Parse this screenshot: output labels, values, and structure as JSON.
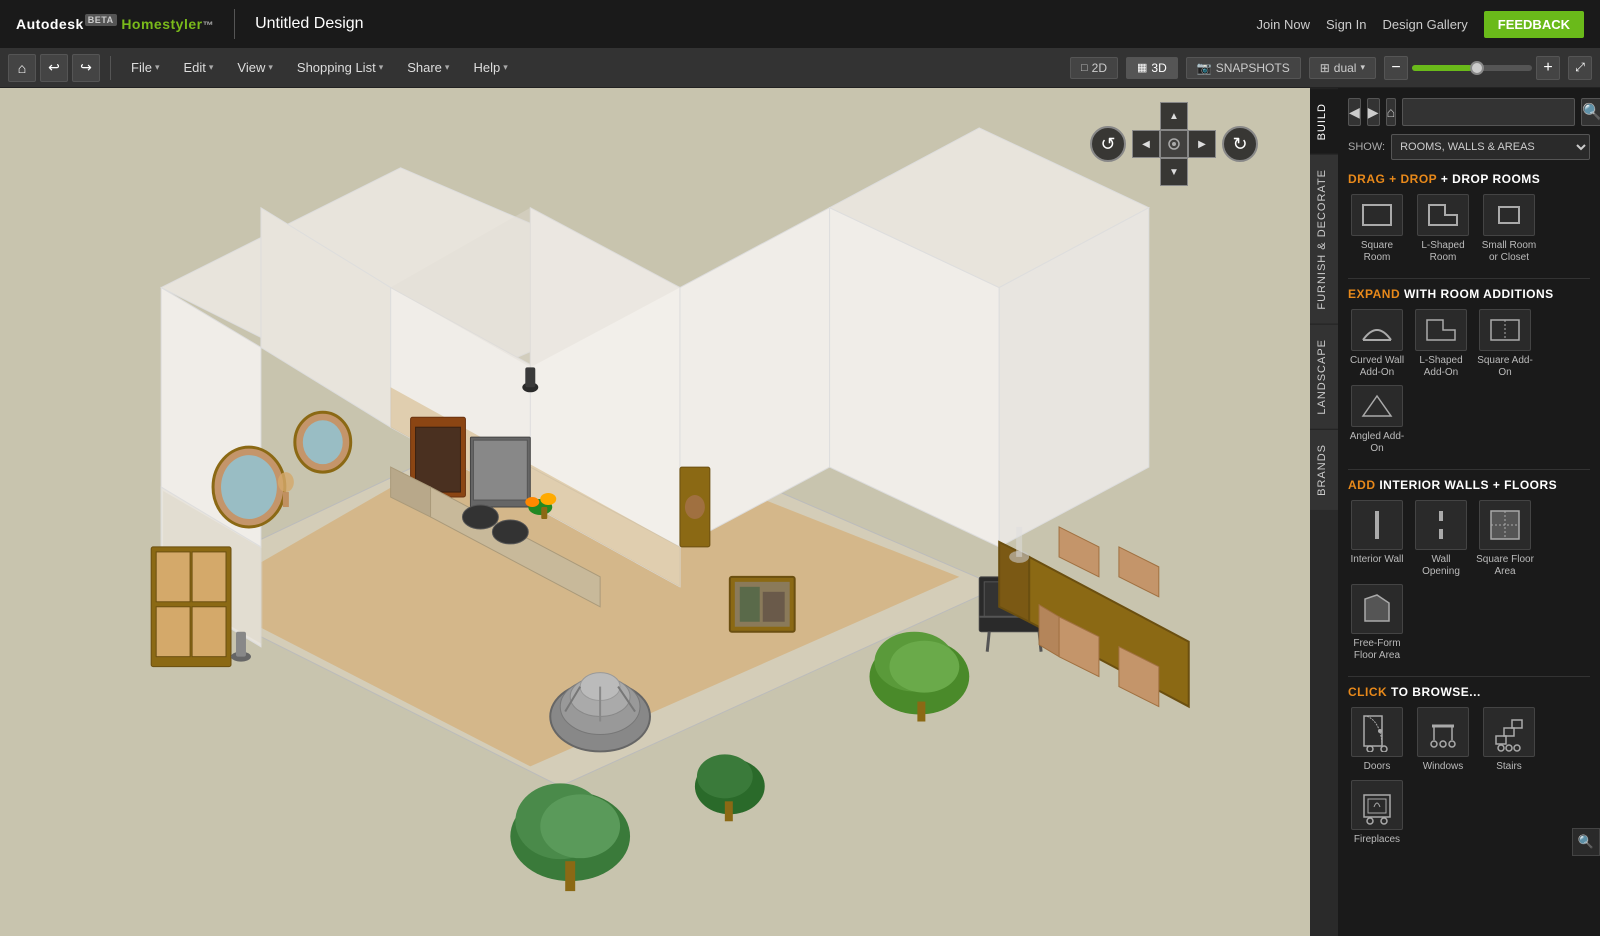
{
  "app": {
    "name": "Autodesk Homestyler",
    "beta_label": "BETA",
    "design_title": "Untitled Design",
    "feedback_btn": "FEEDBACK"
  },
  "top_links": {
    "join_now": "Join Now",
    "sign_in": "Sign In",
    "design_gallery": "Design Gallery"
  },
  "menu": {
    "home_icon": "⌂",
    "undo_icon": "↩",
    "redo_icon": "↪",
    "file": "File",
    "edit": "Edit",
    "view": "View",
    "shopping_list": "Shopping List",
    "share": "Share",
    "help": "Help"
  },
  "view_controls": {
    "btn_2d": "2D",
    "btn_3d": "3D",
    "snapshots": "SNAPSHOTS",
    "dual": "dual",
    "zoom_in": "+",
    "zoom_out": "−",
    "fullscreen": "⤢"
  },
  "nav_control": {
    "rotate_left": "↺",
    "rotate_right": "↻",
    "arrow_up": "▲",
    "arrow_down": "▼",
    "arrow_left": "◀",
    "arrow_right": "▶"
  },
  "panel": {
    "build_tab": "BUILD",
    "furnish_tab": "FURNISH & DECORATE",
    "landscape_tab": "LANDSCAPE",
    "brands_tab": "BRANDS",
    "show_label": "SHOW:",
    "show_option": "ROOMS, WALLS & AREAS",
    "nav_back": "◀",
    "nav_forward": "▶",
    "nav_home": "⌂",
    "search_placeholder": "",
    "search_icon": "🔍"
  },
  "sections": {
    "drag_rooms": {
      "heading_orange": "DRAG + DROP",
      "heading_white": "ROOMS",
      "items": [
        {
          "label": "Square Room",
          "id": "square-room"
        },
        {
          "label": "L-Shaped Room",
          "id": "l-shaped-room"
        },
        {
          "label": "Small Room or Closet",
          "id": "small-room"
        }
      ]
    },
    "expand": {
      "heading_orange": "EXPAND",
      "heading_white": "WITH ROOM ADDITIONS",
      "items": [
        {
          "label": "Curved Wall Add-On",
          "id": "curved-wall"
        },
        {
          "label": "L-Shaped Add-On",
          "id": "l-shaped-add"
        },
        {
          "label": "Square Add-On",
          "id": "square-add"
        },
        {
          "label": "Angled Add-On",
          "id": "angled-add"
        }
      ]
    },
    "interior": {
      "heading_orange": "ADD",
      "heading_white": "INTERIOR WALLS + FLOORS",
      "items": [
        {
          "label": "Interior Wall",
          "id": "interior-wall"
        },
        {
          "label": "Wall Opening",
          "id": "wall-opening"
        },
        {
          "label": "Square Floor Area",
          "id": "square-floor"
        },
        {
          "label": "Free-Form Floor Area",
          "id": "freeform-floor"
        }
      ]
    },
    "browse": {
      "heading_orange": "CLICK",
      "heading_white": "TO BROWSE...",
      "items": [
        {
          "label": "Doors",
          "id": "doors"
        },
        {
          "label": "Windows",
          "id": "windows"
        },
        {
          "label": "Stairs",
          "id": "stairs"
        },
        {
          "label": "Fireplaces",
          "id": "fireplaces"
        }
      ]
    }
  }
}
